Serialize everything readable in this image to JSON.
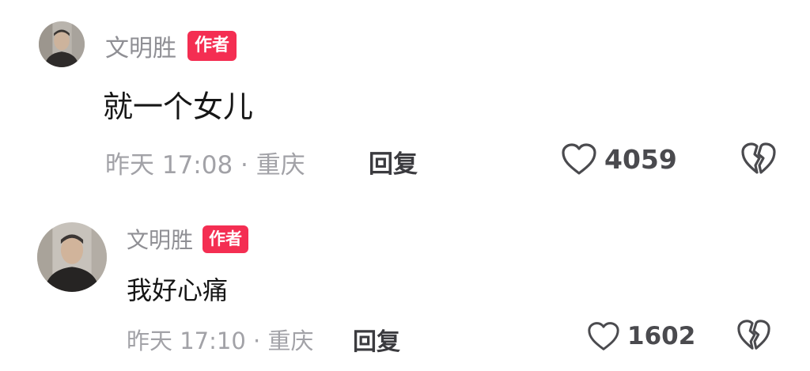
{
  "comments": [
    {
      "author": "文明胜",
      "badge": "作者",
      "text": "就一个女儿",
      "meta": "昨天 17:08 · 重庆",
      "reply_label": "回复",
      "likes": "4059",
      "avatar_icon": "user-avatar",
      "like_icon": "heart-outline-icon",
      "dislike_icon": "broken-heart-icon"
    },
    {
      "author": "文明胜",
      "badge": "作者",
      "text": "我好心痛",
      "meta": "昨天 17:10 · 重庆",
      "reply_label": "回复",
      "likes": "1602",
      "avatar_icon": "user-avatar",
      "like_icon": "heart-outline-icon",
      "dislike_icon": "broken-heart-icon"
    }
  ],
  "colors": {
    "badge_bg": "#f42e52",
    "author_name": "#8f8f94",
    "comment_text": "#161616",
    "meta_text": "#a2a2a7",
    "action_text": "#3b3b3f"
  }
}
